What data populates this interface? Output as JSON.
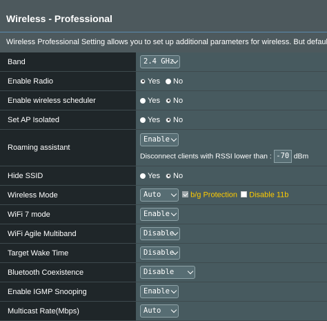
{
  "page": {
    "title": "Wireless - Professional",
    "description": "Wireless Professional Setting allows you to set up additional parameters for wireless. But default values are rec"
  },
  "rows": {
    "band": {
      "label": "Band",
      "value": "2.4 GHz"
    },
    "enable_radio": {
      "label": "Enable Radio",
      "yes": "Yes",
      "no": "No",
      "selected": "Yes"
    },
    "wireless_scheduler": {
      "label": "Enable wireless scheduler",
      "yes": "Yes",
      "no": "No",
      "selected": "No"
    },
    "ap_isolated": {
      "label": "Set AP Isolated",
      "yes": "Yes",
      "no": "No",
      "selected": "No"
    },
    "roaming": {
      "label": "Roaming assistant",
      "value": "Enable",
      "rssi_text": "Disconnect clients with RSSI lower than :",
      "rssi_value": "-70",
      "rssi_unit": "dBm"
    },
    "hide_ssid": {
      "label": "Hide SSID",
      "yes": "Yes",
      "no": "No",
      "selected": "No"
    },
    "wireless_mode": {
      "label": "Wireless Mode",
      "value": "Auto",
      "bg_protection": "b/g Protection",
      "bg_protection_checked": true,
      "disable_11b": "Disable 11b",
      "disable_11b_checked": false
    },
    "wifi7": {
      "label": "WiFi 7 mode",
      "value": "Enable"
    },
    "agile": {
      "label": "WiFi Agile Multiband",
      "value": "Disable"
    },
    "twt": {
      "label": "Target Wake Time",
      "value": "Disable"
    },
    "bluetooth": {
      "label": "Bluetooth Coexistence",
      "value": "Disable"
    },
    "igmp": {
      "label": "Enable IGMP Snooping",
      "value": "Enable"
    },
    "multicast": {
      "label": "Multicast Rate(Mbps)",
      "value": "Auto"
    }
  },
  "colors": {
    "background": "#4d595d",
    "label_cell": "#1f2629",
    "value_cell": "#475a5f",
    "accent_yellow": "#ffcc00",
    "title_rule": "#5b8bb0"
  }
}
